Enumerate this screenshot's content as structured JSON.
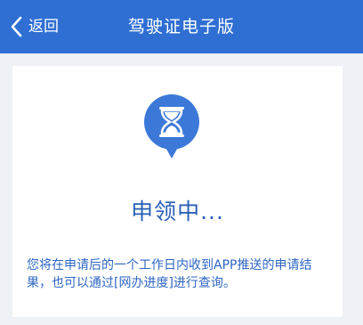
{
  "nav": {
    "back_label": "返回",
    "title": "驾驶证电子版"
  },
  "status": {
    "icon": "hourglass-pin-icon",
    "title": "申领中...",
    "description": "您将在申请后的一个工作日内收到APP推送的申请结果，也可以通过[网办进度]进行查询。"
  },
  "colors": {
    "nav_bg": "#2f6fd3",
    "accent": "#2a5fb6",
    "icon_bg": "#3b78d8",
    "page_bg": "#eef1f5"
  }
}
